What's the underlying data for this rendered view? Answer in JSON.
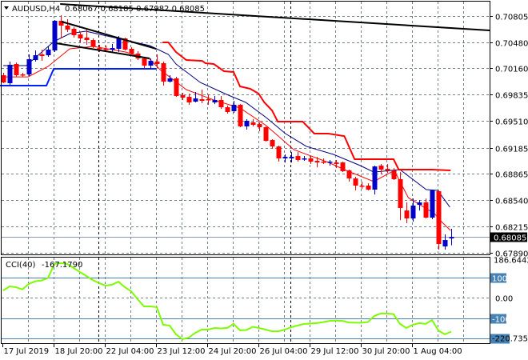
{
  "header": {
    "symbol": "AUDUSD,H4",
    "ohlc": "0.68067 0.68185 0.67982 0.68085"
  },
  "colors": {
    "bull": "#0000c8",
    "bear": "#ff0000",
    "fast_ma": "#ff0000",
    "slow_ma": "#000080",
    "upper_band": "#ff0000",
    "lower_band": "#0020ff",
    "trendline": "#000000",
    "cci": "#7cfc00",
    "level": "#4682b4",
    "grid": "#708090"
  },
  "chart_data": [
    {
      "type": "candlestick",
      "title": "AUDUSD,H4",
      "ylim": [
        0.6789,
        0.70805
      ],
      "y_ticks": [
        "0.70805",
        "0.70480",
        "0.70160",
        "0.69835",
        "0.69510",
        "0.69185",
        "0.68865",
        "0.68540",
        "0.68215",
        "0.67890"
      ],
      "current_price": "0.68085",
      "x_ticks": [
        {
          "bar": 0,
          "label": "17 Jul 2019"
        },
        {
          "bar": 8,
          "label": "18 Jul 20:00"
        },
        {
          "bar": 16,
          "label": "22 Jul 04:00"
        },
        {
          "bar": 24,
          "label": "23 Jul 12:00"
        },
        {
          "bar": 32,
          "label": "24 Jul 20:00"
        },
        {
          "bar": 40,
          "label": "26 Jul 04:00"
        },
        {
          "bar": 48,
          "label": "29 Jul 12:00"
        },
        {
          "bar": 56,
          "label": "30 Jul 20:00"
        },
        {
          "bar": 64,
          "label": "1 Aug 04:00"
        }
      ],
      "period_separators": [
        14.9,
        44.9
      ],
      "candles_ohlc": [
        [
          0.70076,
          0.70106,
          0.69978,
          0.69987
        ],
        [
          0.69978,
          0.70244,
          0.69958,
          0.70204
        ],
        [
          0.70214,
          0.70234,
          0.70056,
          0.70076
        ],
        [
          0.70086,
          0.70106,
          0.70056,
          0.70076
        ],
        [
          0.70086,
          0.70332,
          0.70066,
          0.70273
        ],
        [
          0.70263,
          0.70381,
          0.70244,
          0.70322
        ],
        [
          0.70332,
          0.70391,
          0.70253,
          0.70312
        ],
        [
          0.70322,
          0.70431,
          0.70303,
          0.70391
        ],
        [
          0.70381,
          0.70756,
          0.70362,
          0.70746
        ],
        [
          0.70746,
          0.70815,
          0.70529,
          0.70687
        ],
        [
          0.70687,
          0.70766,
          0.70608,
          0.70638
        ],
        [
          0.70647,
          0.70667,
          0.70539,
          0.70569
        ],
        [
          0.70578,
          0.70608,
          0.7048,
          0.70529
        ],
        [
          0.70539,
          0.70638,
          0.7045,
          0.70509
        ],
        [
          0.70509,
          0.70529,
          0.70411,
          0.70431
        ],
        [
          0.70411,
          0.7045,
          0.70362,
          0.70401
        ],
        [
          0.70401,
          0.70441,
          0.70362,
          0.70391
        ],
        [
          0.70391,
          0.7046,
          0.70362,
          0.70411
        ],
        [
          0.70401,
          0.70559,
          0.70362,
          0.70529
        ],
        [
          0.70529,
          0.70539,
          0.70381,
          0.70391
        ],
        [
          0.70401,
          0.70421,
          0.70332,
          0.70342
        ],
        [
          0.70342,
          0.70372,
          0.70263,
          0.70283
        ],
        [
          0.70283,
          0.70293,
          0.70165,
          0.70194
        ],
        [
          0.70194,
          0.70283,
          0.70155,
          0.70253
        ],
        [
          0.70244,
          0.70332,
          0.70165,
          0.70214
        ],
        [
          0.70224,
          0.70244,
          0.69948,
          0.69997
        ],
        [
          0.69997,
          0.70076,
          0.69987,
          0.70037
        ],
        [
          0.70037,
          0.70056,
          0.6981,
          0.6982
        ],
        [
          0.6983,
          0.69859,
          0.69771,
          0.698
        ],
        [
          0.6981,
          0.6985,
          0.69712,
          0.69741
        ],
        [
          0.69751,
          0.69869,
          0.69741,
          0.6979
        ],
        [
          0.69781,
          0.69899,
          0.69731,
          0.69761
        ],
        [
          0.69781,
          0.6984,
          0.69712,
          0.69771
        ],
        [
          0.69741,
          0.6982,
          0.69721,
          0.69771
        ],
        [
          0.69771,
          0.6982,
          0.69662,
          0.69682
        ],
        [
          0.69682,
          0.69702,
          0.69603,
          0.69623
        ],
        [
          0.69633,
          0.69761,
          0.69613,
          0.69712
        ],
        [
          0.69712,
          0.69721,
          0.69436,
          0.69446
        ],
        [
          0.69446,
          0.69534,
          0.69406,
          0.69515
        ],
        [
          0.69495,
          0.69534,
          0.69446,
          0.69465
        ],
        [
          0.69475,
          0.69495,
          0.69387,
          0.69436
        ],
        [
          0.69436,
          0.69446,
          0.69259,
          0.69268
        ],
        [
          0.69278,
          0.69288,
          0.6917,
          0.69199
        ],
        [
          0.69199,
          0.69209,
          0.69012,
          0.69052
        ],
        [
          0.69052,
          0.69101,
          0.69002,
          0.69071
        ],
        [
          0.69052,
          0.6913,
          0.69002,
          0.69071
        ],
        [
          0.69081,
          0.6913,
          0.69012,
          0.69032
        ],
        [
          0.69042,
          0.69081,
          0.69022,
          0.69052
        ],
        [
          0.69052,
          0.69081,
          0.68983,
          0.69012
        ],
        [
          0.69022,
          0.69071,
          0.68943,
          0.69002
        ],
        [
          0.69012,
          0.69052,
          0.68983,
          0.69002
        ],
        [
          0.69002,
          0.69032,
          0.68963,
          0.69012
        ],
        [
          0.69002,
          0.69032,
          0.68933,
          0.68983
        ],
        [
          0.69002,
          0.69012,
          0.68884,
          0.68894
        ],
        [
          0.68904,
          0.68914,
          0.68766,
          0.68805
        ],
        [
          0.68805,
          0.68825,
          0.68658,
          0.68717
        ],
        [
          0.68717,
          0.68766,
          0.68677,
          0.68707
        ],
        [
          0.68717,
          0.68746,
          0.68658,
          0.68668
        ],
        [
          0.68668,
          0.68963,
          0.68608,
          0.68953
        ],
        [
          0.68963,
          0.68983,
          0.68855,
          0.68914
        ],
        [
          0.68924,
          0.68983,
          0.68874,
          0.68904
        ],
        [
          0.68904,
          0.68933,
          0.68786,
          0.68796
        ],
        [
          0.68796,
          0.68884,
          0.68293,
          0.68441
        ],
        [
          0.68411,
          0.6851,
          0.68254,
          0.68313
        ],
        [
          0.68313,
          0.68559,
          0.68274,
          0.68471
        ],
        [
          0.6848,
          0.68539,
          0.68411,
          0.6851
        ],
        [
          0.6851,
          0.68559,
          0.68313,
          0.68323
        ],
        [
          0.68323,
          0.68658,
          0.68303,
          0.68658
        ],
        [
          0.68648,
          0.68658,
          0.67929,
          0.67998
        ],
        [
          0.67968,
          0.68116,
          0.67929,
          0.68047
        ],
        [
          0.68067,
          0.68185,
          0.67982,
          0.68085
        ]
      ],
      "series": [
        {
          "name": "fast-ma",
          "points": [
            [
              0,
              0.70056
            ],
            [
              3.9,
              0.70056
            ],
            [
              7,
              0.70184
            ],
            [
              10.4,
              0.70401
            ],
            [
              14.1,
              0.70431
            ],
            [
              19.1,
              0.70362
            ],
            [
              22.9,
              0.70273
            ],
            [
              24.5,
              0.70145
            ],
            [
              28.6,
              0.69899
            ],
            [
              32.9,
              0.69771
            ],
            [
              37,
              0.69672
            ],
            [
              41.1,
              0.69456
            ],
            [
              45.4,
              0.6916
            ],
            [
              50.8,
              0.69003
            ],
            [
              53.6,
              0.68904
            ],
            [
              57.9,
              0.68766
            ],
            [
              61.1,
              0.68904
            ],
            [
              63.3,
              0.68569
            ],
            [
              67.4,
              0.68372
            ],
            [
              68.6,
              0.68264
            ],
            [
              69.9,
              0.68165
            ]
          ]
        },
        {
          "name": "slow-ma",
          "points": [
            [
              0,
              0.70194
            ],
            [
              3.6,
              0.70194
            ],
            [
              7.9,
              0.7049
            ],
            [
              10.4,
              0.70588
            ],
            [
              12.9,
              0.70618
            ],
            [
              17.9,
              0.70529
            ],
            [
              22.9,
              0.70441
            ],
            [
              25.8,
              0.70332
            ],
            [
              27,
              0.70214
            ],
            [
              30.8,
              0.69987
            ],
            [
              34.9,
              0.6984
            ],
            [
              37.9,
              0.69741
            ],
            [
              41.1,
              0.69554
            ],
            [
              44.1,
              0.69357
            ],
            [
              47.4,
              0.69199
            ],
            [
              51.6,
              0.69101
            ],
            [
              55.8,
              0.68963
            ],
            [
              57.9,
              0.68884
            ],
            [
              62,
              0.68914
            ],
            [
              66.1,
              0.68668
            ],
            [
              67.9,
              0.68658
            ],
            [
              69.8,
              0.68451
            ]
          ]
        },
        {
          "name": "upper-band",
          "points": [
            [
              24.9,
              0.7048
            ],
            [
              25.8,
              0.7048
            ],
            [
              27,
              0.70362
            ],
            [
              28.6,
              0.70263
            ],
            [
              31.1,
              0.70253
            ],
            [
              31.6,
              0.70224
            ],
            [
              32.9,
              0.70214
            ],
            [
              34.5,
              0.70125
            ],
            [
              36,
              0.70116
            ],
            [
              37,
              0.69938
            ],
            [
              38.6,
              0.69909
            ],
            [
              39.9,
              0.6985
            ],
            [
              40.8,
              0.69741
            ],
            [
              42,
              0.69643
            ],
            [
              42.9,
              0.69505
            ],
            [
              46.8,
              0.69505
            ],
            [
              48.6,
              0.69357
            ],
            [
              50.8,
              0.69357
            ],
            [
              53.3,
              0.69327
            ],
            [
              54.9,
              0.69042
            ],
            [
              61,
              0.69042
            ],
            [
              61.8,
              0.68914
            ],
            [
              67,
              0.68914
            ],
            [
              69.9,
              0.68904
            ]
          ]
        },
        {
          "name": "lower-band",
          "points": [
            [
              -0.5,
              0.69948
            ],
            [
              6.75,
              0.69948
            ],
            [
              7.9,
              0.70155
            ],
            [
              23.9,
              0.70155
            ]
          ]
        }
      ],
      "trendlines": [
        {
          "name": "long-resistance",
          "from": [
            8.9,
            0.70953
          ],
          "to": [
            76,
            0.70628
          ]
        },
        {
          "name": "channel-upper",
          "from": [
            9.1,
            0.70736
          ],
          "to": [
            23.9,
            0.70401
          ]
        },
        {
          "name": "channel-lower",
          "from": [
            8.25,
            0.7047
          ],
          "to": [
            22.9,
            0.70283
          ]
        }
      ]
    },
    {
      "type": "line",
      "title": "CCI(40)",
      "current_value": "-167.1790",
      "ylim": [
        -220.735,
        186.6442
      ],
      "max_label": "186.6442",
      "min_label": "-220.735",
      "levels": [
        {
          "value": 100,
          "label": "100"
        },
        {
          "value": 0,
          "label": "0.00"
        },
        {
          "value": -100,
          "label": "-100"
        },
        {
          "value": -200,
          "label": ""
        }
      ],
      "values": [
        35,
        55,
        51,
        40,
        67,
        80,
        84,
        96,
        165,
        169,
        165,
        145,
        125,
        106,
        86,
        71,
        59,
        63,
        78,
        51,
        31,
        -8,
        -43,
        -43,
        -47,
        -133,
        -137,
        -180,
        -204,
        -196,
        -173,
        -157,
        -157,
        -149,
        -151,
        -149,
        -129,
        -160,
        -159,
        -143,
        -149,
        -157,
        -165,
        -165,
        -157,
        -145,
        -137,
        -129,
        -127,
        -125,
        -120,
        -114,
        -113,
        -114,
        -122,
        -123,
        -123,
        -120,
        -90,
        -78,
        -78,
        -81,
        -129,
        -149,
        -133,
        -125,
        -129,
        -110,
        -161,
        -180,
        -167.179
      ]
    }
  ]
}
